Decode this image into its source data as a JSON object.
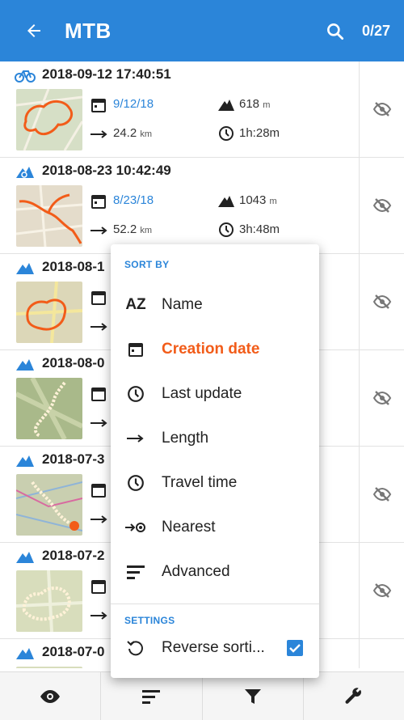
{
  "appbar": {
    "title": "MTB",
    "counter": "0/27",
    "back_icon": "arrow-back-icon",
    "search_icon": "search-icon"
  },
  "colors": {
    "accent": "#2b85d9",
    "active": "#f25c19"
  },
  "tracks": [
    {
      "title": "2018-09-12 17:40:51",
      "type": "bike",
      "date": "9/12/18",
      "elevation": "618",
      "elevation_unit": "m",
      "length": "24.2",
      "length_unit": "km",
      "duration": "1h:28m"
    },
    {
      "title": "2018-08-23 10:42:49",
      "type": "mtb",
      "date": "8/23/18",
      "elevation": "1043",
      "elevation_unit": "m",
      "length": "52.2",
      "length_unit": "km",
      "duration": "3h:48m"
    },
    {
      "title": "2018-08-1",
      "type": "mtb"
    },
    {
      "title": "2018-08-0",
      "type": "mtb"
    },
    {
      "title": "2018-07-3",
      "type": "mtb"
    },
    {
      "title": "2018-07-2",
      "type": "mtb"
    },
    {
      "title": "2018-07-0",
      "type": "mtb"
    }
  ],
  "sort_menu": {
    "header": "SORT BY",
    "items": [
      {
        "label": "Name",
        "icon": "az-icon",
        "active": false
      },
      {
        "label": "Creation date",
        "icon": "calendar-icon",
        "active": true
      },
      {
        "label": "Last update",
        "icon": "clock-icon",
        "active": false
      },
      {
        "label": "Length",
        "icon": "arrow-right-icon",
        "active": false
      },
      {
        "label": "Travel time",
        "icon": "clock-icon",
        "active": false
      },
      {
        "label": "Nearest",
        "icon": "nearest-icon",
        "active": false
      },
      {
        "label": "Advanced",
        "icon": "sort-lines-icon",
        "active": false
      }
    ],
    "settings_header": "SETTINGS",
    "reverse_label": "Reverse sorti...",
    "reverse_checked": true
  },
  "bottom_bar": [
    "eye-icon",
    "sort-icon",
    "filter-icon",
    "wrench-icon"
  ]
}
